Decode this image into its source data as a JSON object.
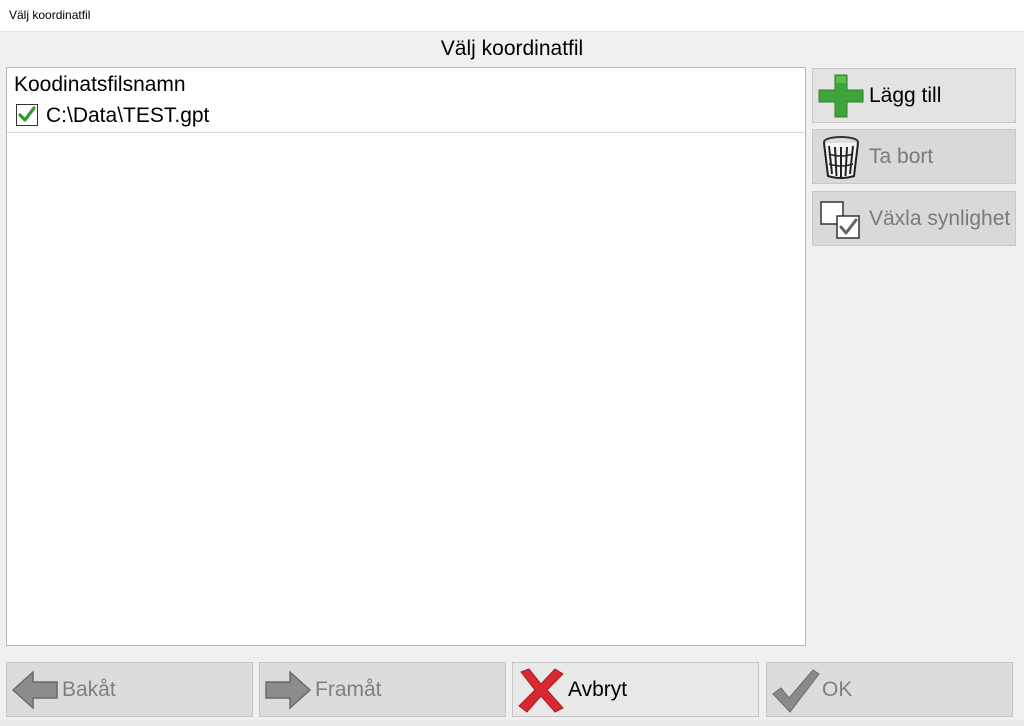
{
  "window": {
    "title": "Välj koordinatfil"
  },
  "dialog": {
    "heading": "Välj koordinatfil"
  },
  "file_list": {
    "column_header": "Koodinatsfilsnamn",
    "rows": [
      {
        "checked": true,
        "path": "C:\\Data\\TEST.gpt"
      }
    ]
  },
  "side_buttons": {
    "add_label": "Lägg till",
    "remove_label": "Ta bort",
    "toggle_label": "Växla synlighet"
  },
  "bottom_buttons": {
    "back_label": "Bakåt",
    "forward_label": "Framåt",
    "cancel_label": "Avbryt",
    "ok_label": "OK"
  },
  "icons": {
    "add": "plus-icon",
    "remove": "trash-icon",
    "toggle": "visibility-toggle-icon",
    "back": "arrow-left-icon",
    "forward": "arrow-right-icon",
    "cancel": "red-x-icon",
    "ok": "checkmark-icon"
  },
  "colors": {
    "add_green": "#3fa53a",
    "cancel_red": "#d9282f",
    "check_green": "#2e9d2e",
    "disabled_gray": "#7f7f7f"
  }
}
